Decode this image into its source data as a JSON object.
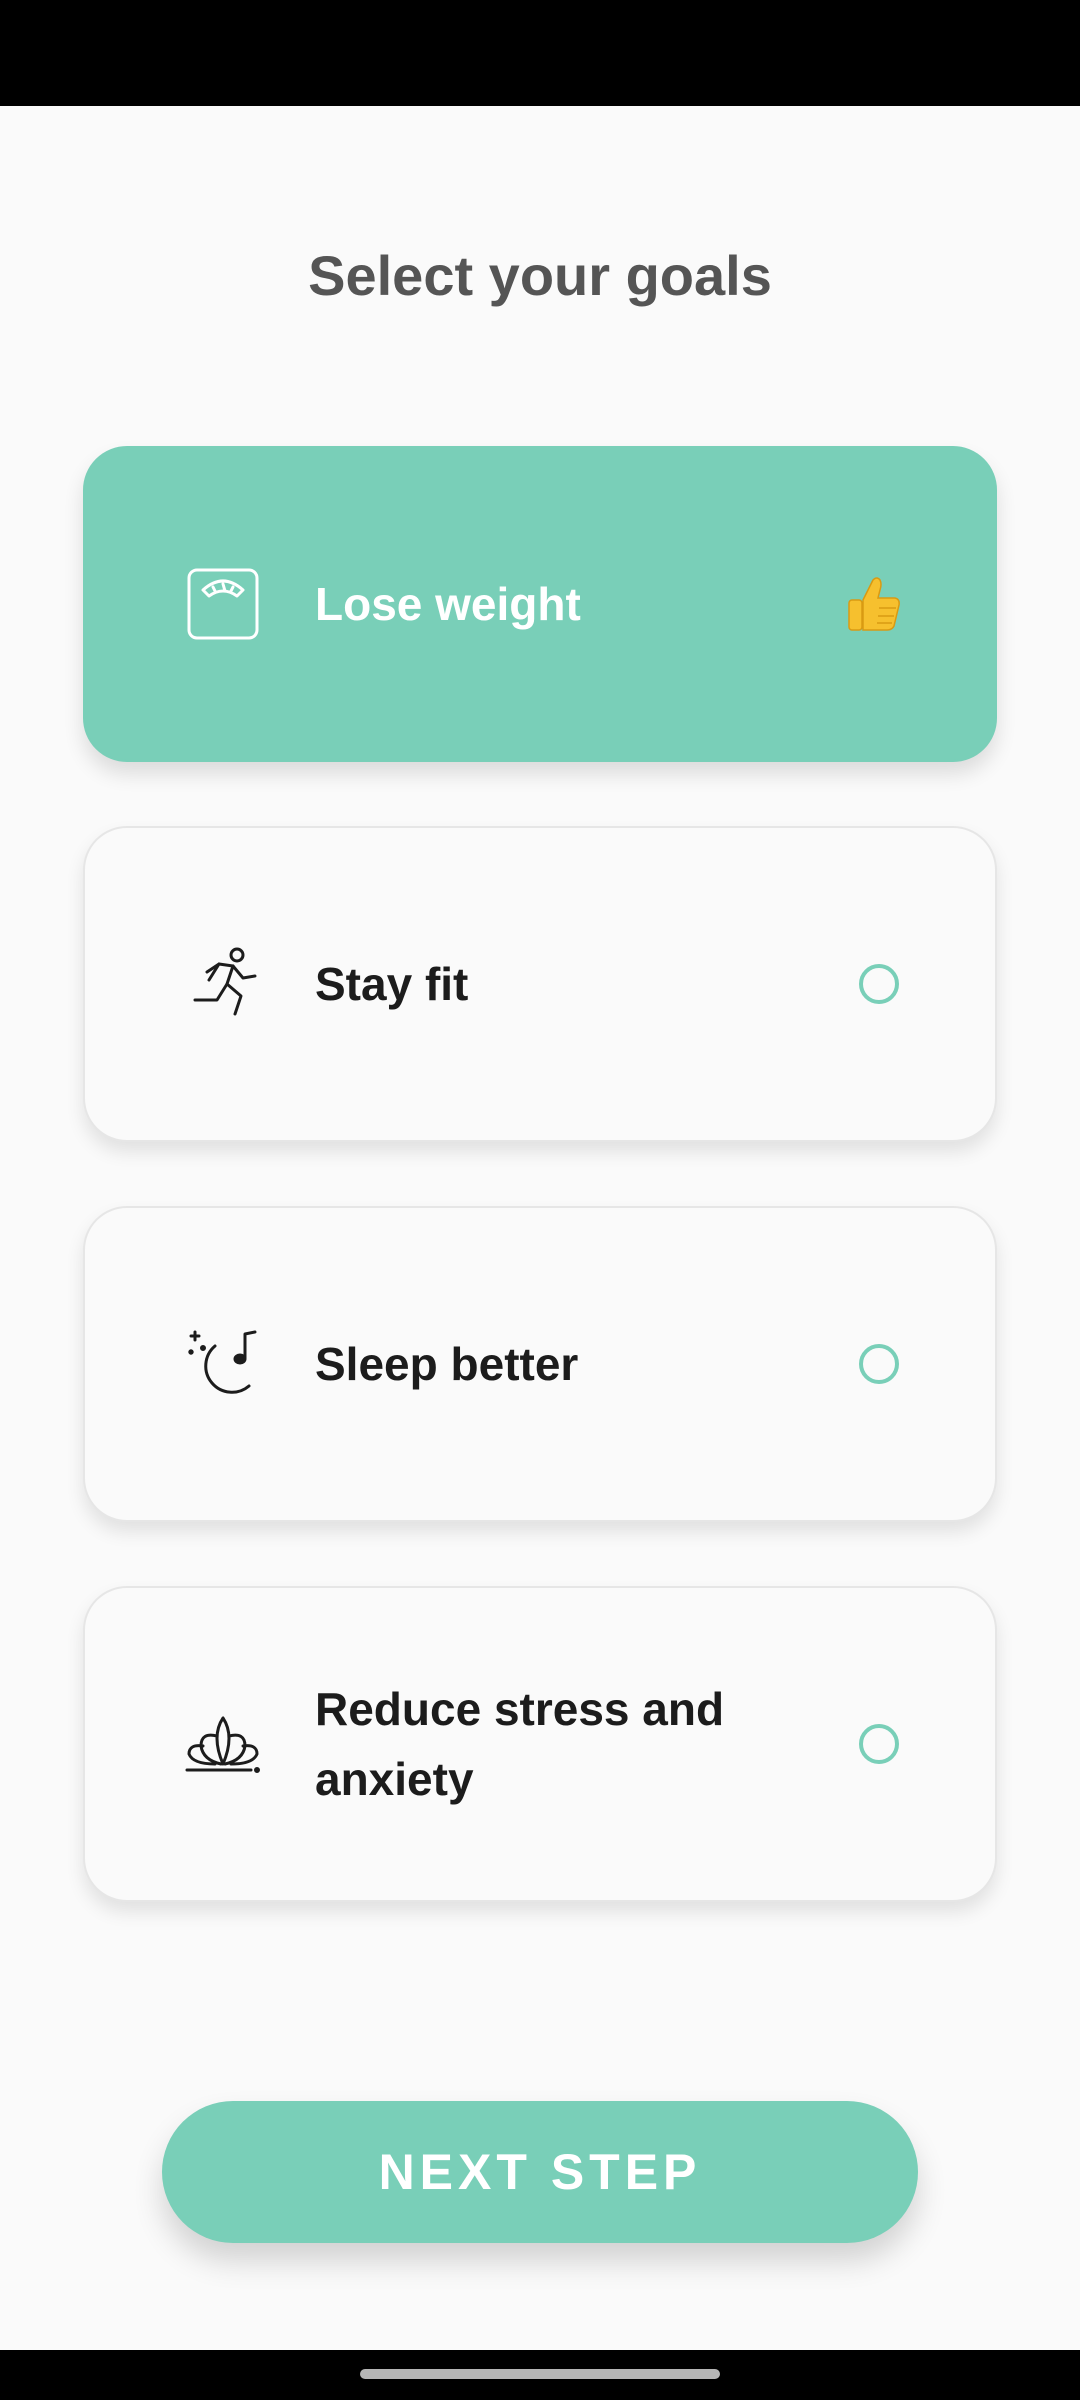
{
  "screen": {
    "title": "Select your goals"
  },
  "colors": {
    "accent": "#79cfb8",
    "background": "#fafafa",
    "title_text": "#555555",
    "label_text": "#1c1c1c"
  },
  "goals": [
    {
      "label": "Lose weight",
      "icon": "bathroom-scale-icon",
      "selected": true,
      "indicator": "thumbs-up-icon"
    },
    {
      "label": "Stay fit",
      "icon": "running-person-icon",
      "selected": false,
      "indicator": "radio-circle"
    },
    {
      "label": "Sleep better",
      "icon": "moon-music-note-icon",
      "selected": false,
      "indicator": "radio-circle"
    },
    {
      "label": "Reduce stress and anxiety",
      "icon": "lotus-icon",
      "selected": false,
      "indicator": "radio-circle"
    }
  ],
  "actions": {
    "next_label": "NEXT STEP"
  }
}
